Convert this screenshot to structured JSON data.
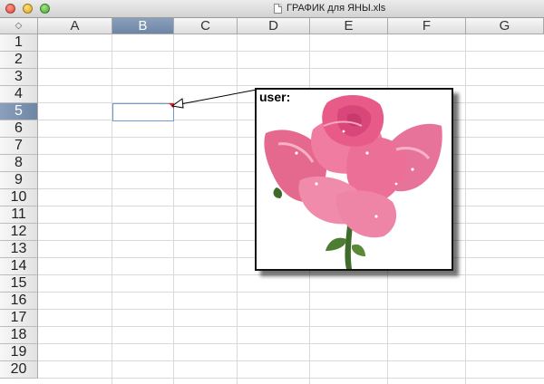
{
  "window": {
    "title": "ГРАФИК для ЯНЫ.xls"
  },
  "sheet": {
    "select_all_symbol": "◇",
    "columns": [
      "A",
      "B",
      "C",
      "D",
      "E",
      "F",
      "G"
    ],
    "rows": [
      "1",
      "2",
      "3",
      "4",
      "5",
      "6",
      "7",
      "8",
      "9",
      "10",
      "11",
      "12",
      "13",
      "14",
      "15",
      "16",
      "17",
      "18",
      "19",
      "20"
    ],
    "selected_column": "B",
    "selected_row": "5",
    "active_cell": "B5"
  },
  "comment": {
    "author": "user:",
    "image": "pink-rose-photo",
    "marker_color": "#e32020"
  },
  "colors": {
    "header_selected": "#7a91b0",
    "gridline": "#d9d9d9",
    "active_cell_border": "#6f9bd1"
  }
}
